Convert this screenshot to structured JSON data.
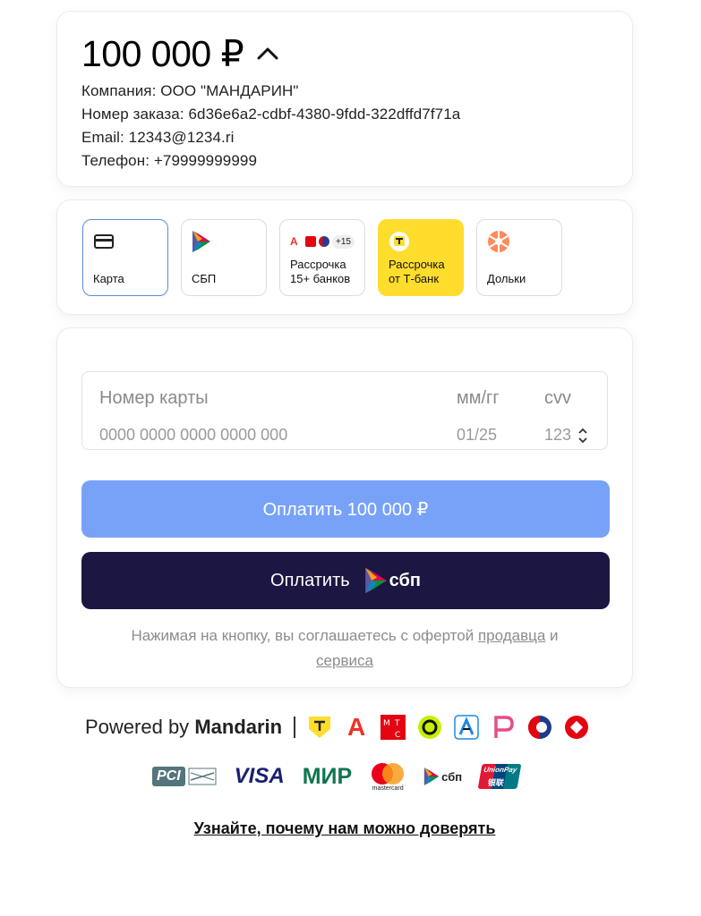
{
  "summary": {
    "amount": "100 000 ₽",
    "company": "Компания: ООО \"МАНДАРИН\"",
    "order": "Номер заказа: 6d36e6a2-cdbf-4380-9fdd-322dffd7f71a",
    "email": "Email: 12343@1234.ri",
    "phone": "Телефон: +79999999999"
  },
  "methods": [
    {
      "label": "Карта",
      "icon": "card-icon"
    },
    {
      "label": "СБП",
      "icon": "sbp-icon"
    },
    {
      "label1": "Рассрочка",
      "label2": "15+ банков",
      "badge": "+15",
      "icon": "banks-icon"
    },
    {
      "label1": "Рассрочка",
      "label2": "от Т-банк",
      "icon": "tbank-icon"
    },
    {
      "label": "Дольки",
      "icon": "dolyami-icon"
    }
  ],
  "form": {
    "card_label": "Номер карты",
    "card_placeholder": "0000 0000 0000 0000 000",
    "exp_label": "мм/гг",
    "exp_placeholder": "01/25",
    "cvv_label": "cvv",
    "cvv_placeholder": "123",
    "pay_button": "Оплатить 100 000 ₽",
    "sbp_button": "Оплатить",
    "sbp_logo": "сбп",
    "agree_text": "Нажимая на кнопку, вы соглашаетесь с офертой",
    "agree_link1": "продавца",
    "agree_and": "и",
    "agree_link2": "сервиса"
  },
  "footer": {
    "powered": "Powered by",
    "brand": "Mandarin",
    "trust_link": "Узнайте, почему нам можно доверять",
    "visa": "VISA",
    "mir": "МИР",
    "sbp": "сбп",
    "mastercard": "mastercard",
    "pci": "PCI",
    "unionpay": "UnionPay",
    "unionpay_cn": "银联"
  },
  "colors": {
    "accent": "#78a2f8",
    "dark": "#1c1642",
    "tbank": "#ffdd2d",
    "selected": "#5b8ad9"
  }
}
